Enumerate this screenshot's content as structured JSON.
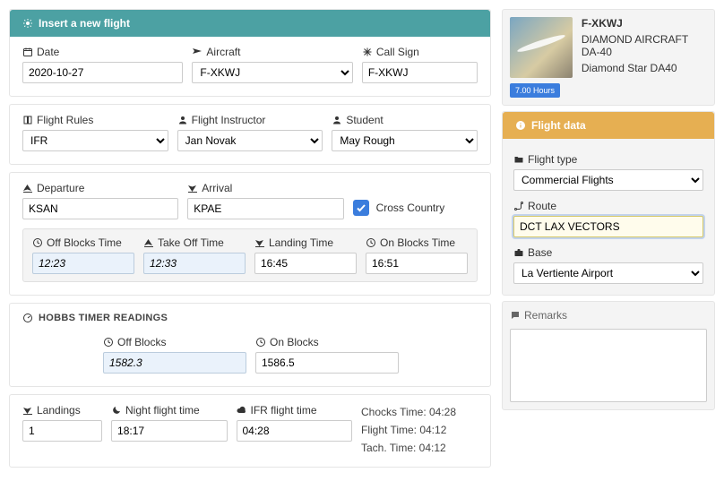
{
  "header": {
    "insert_title": "Insert a new flight"
  },
  "labels": {
    "date": "Date",
    "aircraft": "Aircraft",
    "call_sign": "Call Sign",
    "flight_rules": "Flight Rules",
    "flight_instructor": "Flight Instructor",
    "student": "Student",
    "departure": "Departure",
    "arrival": "Arrival",
    "cross_country": "Cross Country",
    "off_blocks_time": "Off Blocks Time",
    "take_off_time": "Take Off Time",
    "landing_time": "Landing Time",
    "on_blocks_time": "On Blocks Time",
    "hobbs_section": "HOBBS TIMER READINGS",
    "off_blocks": "Off Blocks",
    "on_blocks": "On Blocks",
    "landings": "Landings",
    "night_time": "Night flight time",
    "ifr_time": "IFR flight time",
    "flight_type": "Flight type",
    "route": "Route",
    "base": "Base",
    "remarks": "Remarks",
    "flight_data_header": "Flight data"
  },
  "values": {
    "date": "2020-10-27",
    "aircraft": "F-XKWJ",
    "call_sign": "F-XKWJ",
    "flight_rules": "IFR",
    "flight_instructor": "Jan Novak",
    "student": "May Rough",
    "departure": "KSAN",
    "arrival": "KPAE",
    "cross_country": true,
    "off_blocks_time": "12:23",
    "take_off_time": "12:33",
    "landing_time": "16:45",
    "on_blocks_time": "16:51",
    "off_blocks": "1582.3",
    "on_blocks": "1586.5",
    "landings": "1",
    "night_time": "18:17",
    "ifr_time": "04:28",
    "flight_type": "Commercial Flights",
    "route": "DCT LAX VECTORS",
    "base": "La Vertiente Airport",
    "remarks": ""
  },
  "computed": {
    "chocks_time": "Chocks Time: 04:28",
    "flight_time": "Flight Time: 04:12",
    "tach_time": "Tach. Time: 04:12"
  },
  "aircraft_panel": {
    "registration": "F-XKWJ",
    "type_line1": "DIAMOND AIRCRAFT DA-40",
    "type_line2": "Diamond Star DA40",
    "hours_badge": "7.00 Hours"
  }
}
